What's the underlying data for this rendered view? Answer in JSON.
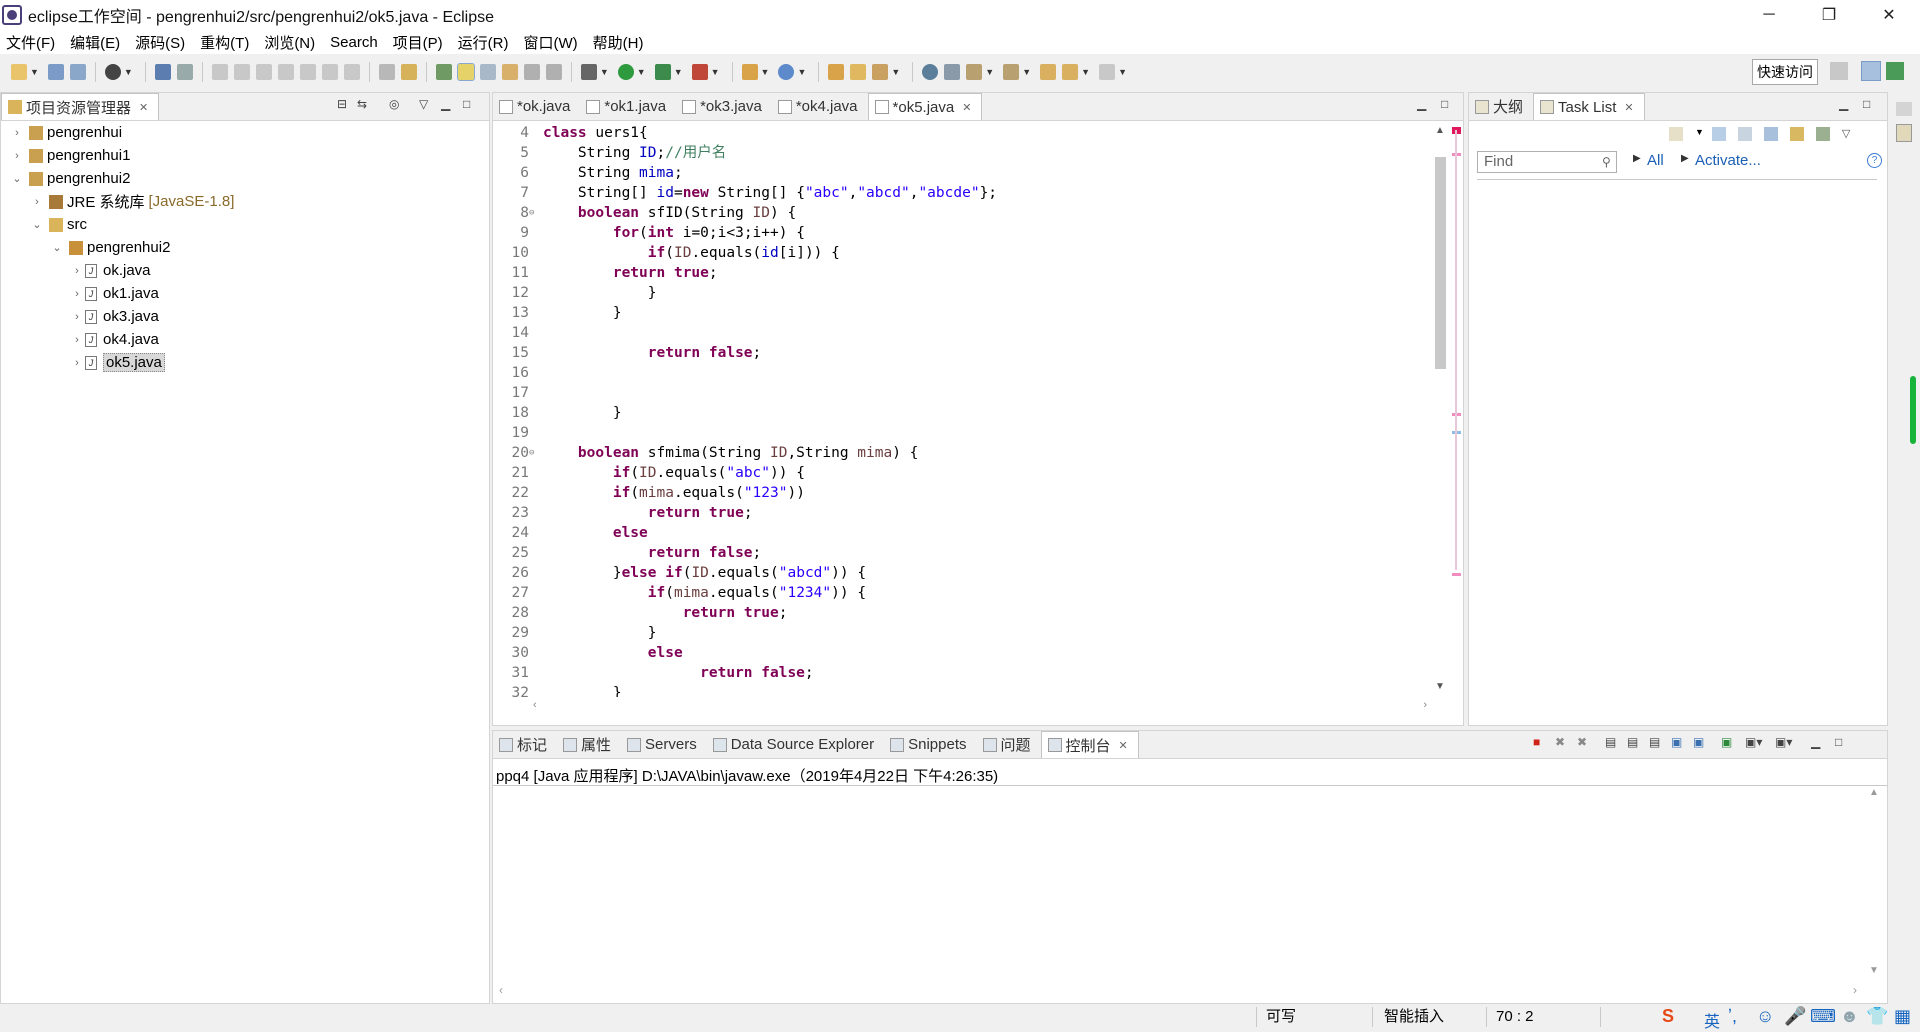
{
  "window": {
    "title": "eclipse工作空间 - pengrenhui2/src/pengrenhui2/ok5.java - Eclipse"
  },
  "menu": [
    "文件(F)",
    "编辑(E)",
    "源码(S)",
    "重构(T)",
    "浏览(N)",
    "Search",
    "项目(P)",
    "运行(R)",
    "窗口(W)",
    "帮助(H)"
  ],
  "quick_access": "快速访问",
  "explorer": {
    "title": "项目资源管理器",
    "items": [
      {
        "label": "pengrenhui",
        "indent": 0,
        "twisty": "›",
        "icon": "project"
      },
      {
        "label": "pengrenhui1",
        "indent": 0,
        "twisty": "›",
        "icon": "project"
      },
      {
        "label": "pengrenhui2",
        "indent": 0,
        "twisty": "⌄",
        "icon": "project"
      },
      {
        "label": "JRE 系统库",
        "suffix": "[JavaSE-1.8]",
        "indent": 1,
        "twisty": "›",
        "icon": "library"
      },
      {
        "label": "src",
        "indent": 1,
        "twisty": "⌄",
        "icon": "folder"
      },
      {
        "label": "pengrenhui2",
        "indent": 2,
        "twisty": "⌄",
        "icon": "package"
      },
      {
        "label": "ok.java",
        "indent": 3,
        "twisty": "›",
        "icon": "file"
      },
      {
        "label": "ok1.java",
        "indent": 3,
        "twisty": "›",
        "icon": "file"
      },
      {
        "label": "ok3.java",
        "indent": 3,
        "twisty": "›",
        "icon": "file"
      },
      {
        "label": "ok4.java",
        "indent": 3,
        "twisty": "›",
        "icon": "file"
      },
      {
        "label": "ok5.java",
        "indent": 3,
        "twisty": "›",
        "icon": "file",
        "selected": true
      }
    ]
  },
  "editor": {
    "tabs": [
      {
        "label": "*ok.java",
        "active": false
      },
      {
        "label": "*ok1.java",
        "active": false
      },
      {
        "label": "*ok3.java",
        "active": false
      },
      {
        "label": "*ok4.java",
        "active": false
      },
      {
        "label": "*ok5.java",
        "active": true
      }
    ],
    "lines": [
      {
        "n": "4",
        "fold": "",
        "code": "[[k:class]] uers1{"
      },
      {
        "n": "5",
        "fold": "",
        "code": "    String [[f:ID]];[[c://用户名]]"
      },
      {
        "n": "6",
        "fold": "",
        "code": "    String [[f:mima]];"
      },
      {
        "n": "7",
        "fold": "",
        "code": "    String[] [[f:id]]=[[k:new]] String[] {[[s:\"abc\"]],[[s:\"abcd\"]],[[s:\"abcde\"]]};"
      },
      {
        "n": "8",
        "fold": "⊖",
        "code": "    [[k:boolean]] sfID(String [[p:ID]]) {"
      },
      {
        "n": "9",
        "fold": "",
        "code": "        [[k:for]]([[k:int]] i=0;i<3;i++) {"
      },
      {
        "n": "10",
        "fold": "",
        "code": "            [[k:if]]([[p:ID]].equals([[f:id]][i])) {"
      },
      {
        "n": "11",
        "fold": "",
        "code": "        [[k:return]] [[k:true]];"
      },
      {
        "n": "12",
        "fold": "",
        "code": "            }"
      },
      {
        "n": "13",
        "fold": "",
        "code": "        }"
      },
      {
        "n": "14",
        "fold": "",
        "code": ""
      },
      {
        "n": "15",
        "fold": "",
        "code": "            [[k:return]] [[k:false]];"
      },
      {
        "n": "16",
        "fold": "",
        "code": ""
      },
      {
        "n": "17",
        "fold": "",
        "code": ""
      },
      {
        "n": "18",
        "fold": "",
        "code": "        }"
      },
      {
        "n": "19",
        "fold": "",
        "code": ""
      },
      {
        "n": "20",
        "fold": "⊖",
        "code": "    [[k:boolean]] sfmima(String [[p:ID]],String [[p:mima]]) {"
      },
      {
        "n": "21",
        "fold": "",
        "code": "        [[k:if]]([[p:ID]].equals([[s:\"abc\"]])) {"
      },
      {
        "n": "22",
        "fold": "",
        "code": "        [[k:if]]([[p:mima]].equals([[s:\"123\"]]))"
      },
      {
        "n": "23",
        "fold": "",
        "code": "            [[k:return]] [[k:true]];"
      },
      {
        "n": "24",
        "fold": "",
        "code": "        [[k:else]]"
      },
      {
        "n": "25",
        "fold": "",
        "code": "            [[k:return]] [[k:false]];"
      },
      {
        "n": "26",
        "fold": "",
        "code": "        }[[k:else]] [[k:if]]([[p:ID]].equals([[s:\"abcd\"]])) {"
      },
      {
        "n": "27",
        "fold": "",
        "code": "            [[k:if]]([[p:mima]].equals([[s:\"1234\"]])) {"
      },
      {
        "n": "28",
        "fold": "",
        "code": "                [[k:return]] [[k:true]];"
      },
      {
        "n": "29",
        "fold": "",
        "code": "            }"
      },
      {
        "n": "30",
        "fold": "",
        "code": "            [[k:else]]"
      },
      {
        "n": "31",
        "fold": "",
        "code": "                  [[k:return]] [[k:false]];"
      },
      {
        "n": "32",
        "fold": "",
        "code": "        }"
      }
    ]
  },
  "tasks": {
    "tabs": [
      {
        "label": "大纲",
        "active": false
      },
      {
        "label": "Task List",
        "active": true
      }
    ],
    "find_placeholder": "Find",
    "all_label": "All",
    "activate_label": "Activate..."
  },
  "console": {
    "tabs": [
      {
        "label": "标记",
        "active": false
      },
      {
        "label": "属性",
        "active": false
      },
      {
        "label": "Servers",
        "active": false
      },
      {
        "label": "Data Source Explorer",
        "active": false
      },
      {
        "label": "Snippets",
        "active": false
      },
      {
        "label": "问题",
        "active": false
      },
      {
        "label": "控制台",
        "active": true
      }
    ],
    "text": "ppq4 [Java 应用程序] D:\\JAVA\\bin\\javaw.exe（2019年4月22日 下午4:26:35)"
  },
  "status": {
    "writable": "可写",
    "insert_mode": "智能插入",
    "position": "70 : 2"
  },
  "ime": {
    "lang": "英"
  },
  "colors": {
    "keyword": "#7f0055",
    "string": "#2a00ff",
    "comment": "#3f7f5f",
    "field": "#0000c0",
    "param": "#6a3e3e"
  }
}
